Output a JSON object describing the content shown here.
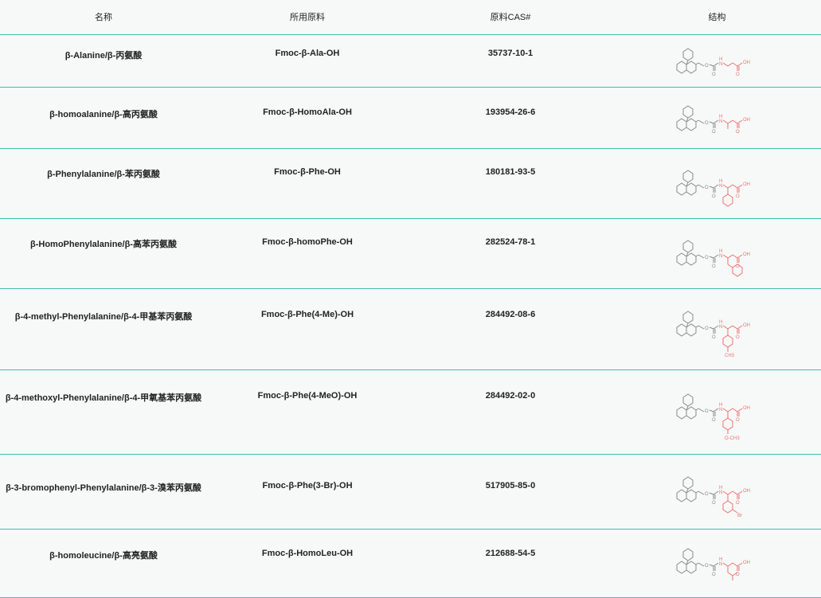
{
  "headers": [
    "名称",
    "所用原料",
    "原料CAS#",
    "结构"
  ],
  "rows": [
    {
      "name": "β-Alanine/β-丙氨酸",
      "material": "Fmoc-β-Ala-OH",
      "cas": "35737-10-1",
      "structure": "beta-ala"
    },
    {
      "name": "β-homoalanine/β-高丙氨酸",
      "material": "Fmoc-β-HomoAla-OH",
      "cas": "193954-26-6",
      "structure": "beta-homoala"
    },
    {
      "name": "β-Phenylalanine/β-苯丙氨酸",
      "material": "Fmoc-β-Phe-OH",
      "cas": "180181-93-5",
      "structure": "beta-phe"
    },
    {
      "name": "β-HomoPhenylalanine/β-高苯丙氨酸",
      "material": "Fmoc-β-homoPhe-OH",
      "cas": "282524-78-1",
      "structure": "beta-homophe"
    },
    {
      "name": "β-4-methyl-Phenylalanine/β-4-甲基苯丙氨酸",
      "material": "Fmoc-β-Phe(4-Me)-OH",
      "cas": "284492-08-6",
      "structure": "beta-phe-4me"
    },
    {
      "name": "β-4-methoxyl-Phenylalanine/β-4-甲氧基苯丙氨酸",
      "material": "Fmoc-β-Phe(4-MeO)-OH",
      "cas": "284492-02-0",
      "structure": "beta-phe-4meo"
    },
    {
      "name": "β-3-bromophenyl-Phenylalanine/β-3-溴苯丙氨酸",
      "material": "Fmoc-β-Phe(3-Br)-OH",
      "cas": "517905-85-0",
      "structure": "beta-phe-3br"
    },
    {
      "name": "β-homoleucine/β-高亮氨酸",
      "material": "Fmoc-β-HomoLeu-OH",
      "cas": "212688-54-5",
      "structure": "beta-homoleu"
    }
  ],
  "structure_labels": {
    "nh": "H",
    "n": "N",
    "o": "O",
    "oh": "OH",
    "ch3": "CH3",
    "och3": "O-CH3",
    "br": "Br"
  }
}
